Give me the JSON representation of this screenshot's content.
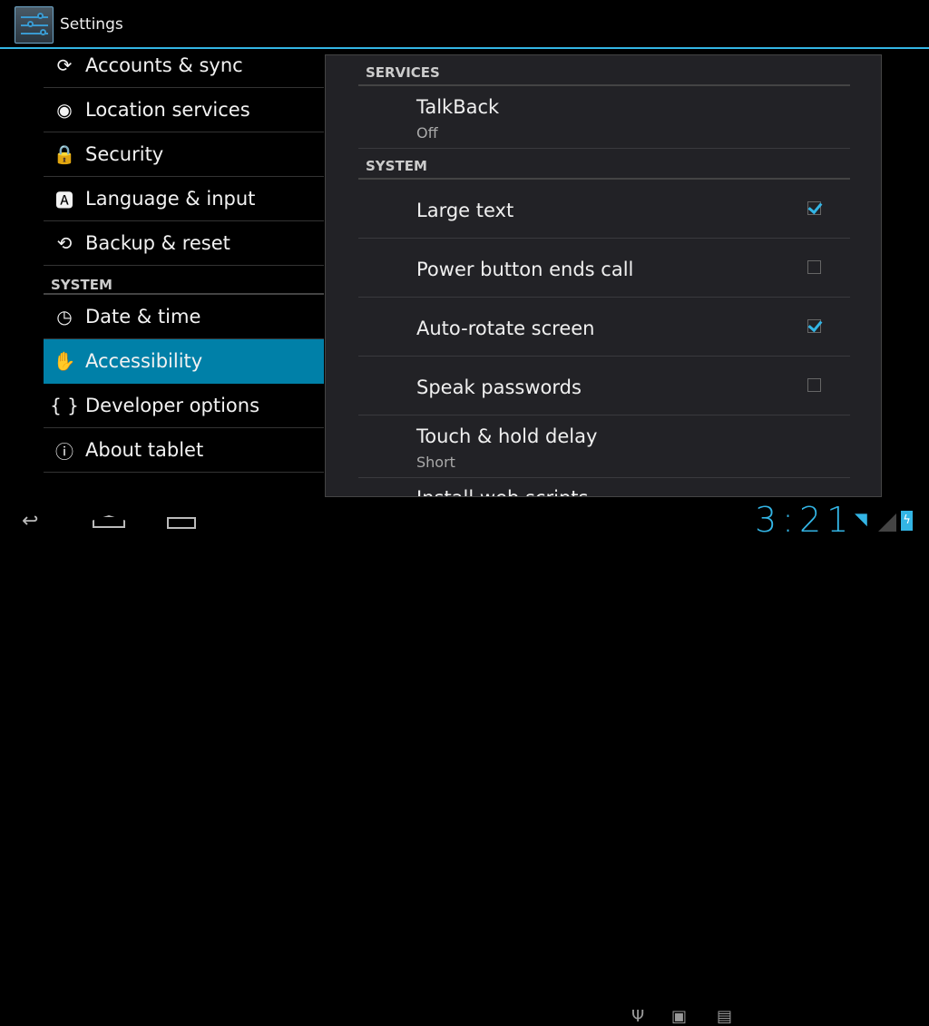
{
  "app": {
    "title": "Settings"
  },
  "left": {
    "items": [
      {
        "label": "Accounts & sync",
        "icon": "sync-icon",
        "glyph": "⟳"
      },
      {
        "label": "Location services",
        "icon": "location-icon",
        "glyph": "◉"
      },
      {
        "label": "Security",
        "icon": "lock-icon",
        "glyph": "🔒"
      },
      {
        "label": "Language & input",
        "icon": "keyboard-a-icon",
        "glyph": "🅰"
      },
      {
        "label": "Backup & reset",
        "icon": "backup-icon",
        "glyph": "⟲"
      }
    ],
    "section": "SYSTEM",
    "items2": [
      {
        "label": "Date & time",
        "icon": "clock-icon",
        "glyph": "◷"
      },
      {
        "label": "Accessibility",
        "icon": "hand-icon",
        "glyph": "✋",
        "selected": true
      },
      {
        "label": "Developer options",
        "icon": "braces-icon",
        "glyph": "{ }"
      },
      {
        "label": "About tablet",
        "icon": "info-icon",
        "glyph": "ⓘ"
      }
    ]
  },
  "right": {
    "services_header": "SERVICES",
    "talkback": {
      "title": "TalkBack",
      "summary": "Off"
    },
    "system_header": "SYSTEM",
    "items": [
      {
        "title": "Large text",
        "checked": true
      },
      {
        "title": "Power button ends call",
        "checked": false
      },
      {
        "title": "Auto-rotate screen",
        "checked": true
      },
      {
        "title": "Speak passwords",
        "checked": false
      }
    ],
    "touch": {
      "title": "Touch & hold delay",
      "summary": "Short"
    },
    "partial": "Install web scripts"
  },
  "status": {
    "time": "3:21",
    "accent": "#33b5e5"
  }
}
